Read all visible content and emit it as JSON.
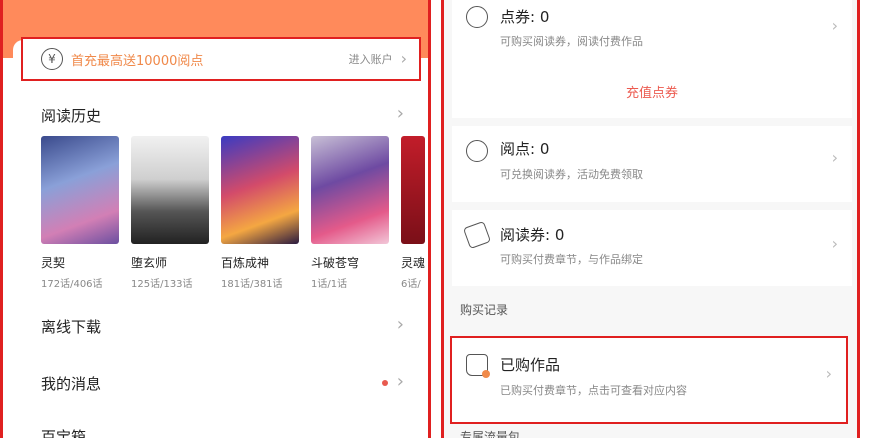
{
  "left": {
    "promo": {
      "text": "首充最高送10000阅点",
      "account": "进入账户"
    },
    "history": {
      "title": "阅读历史",
      "books": [
        {
          "name": "灵契",
          "progress": "172话/406话"
        },
        {
          "name": "堕玄师",
          "progress": "125话/133话"
        },
        {
          "name": "百炼成神",
          "progress": "181话/381话"
        },
        {
          "name": "斗破苍穹",
          "progress": "1话/1话"
        },
        {
          "name": "灵魂",
          "progress": "6话/"
        }
      ]
    },
    "offline": "离线下载",
    "messages": "我的消息",
    "bookshelf": "百宝箱"
  },
  "right": {
    "coupon": {
      "title": "点券: 0",
      "sub": "可购买阅读券，阅读付费作品"
    },
    "recharge": "充值点券",
    "points": {
      "title": "阅点: 0",
      "sub": "可兑换阅读券，活动免费领取"
    },
    "ticket": {
      "title": "阅读券: 0",
      "sub": "可购买付费章节，与作品绑定"
    },
    "purchase_label": "购买记录",
    "purchased": {
      "title": "已购作品",
      "sub": "已购买付费章节，点击可查看对应内容"
    },
    "next_label": "专属流量包"
  },
  "icons": {
    "yen": "¥",
    "chevron": "›"
  }
}
